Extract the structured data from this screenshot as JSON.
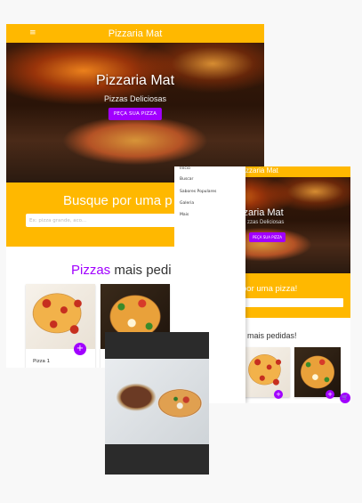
{
  "desktop": {
    "brand": "Pizzaria Mat",
    "menu_icon": "hamburger-icon",
    "hero": {
      "title": "Pizzaria Mat",
      "subtitle": "Pizzas Deliciosas",
      "button": "PEÇA SUA PIZZA"
    },
    "search": {
      "title": "Busque por uma p",
      "placeholder": "Ex: pizza grande, aco..."
    },
    "popular": {
      "title_accent": "Pizzas",
      "title_rest": " mais pedi"
    },
    "cards": [
      {
        "name": "Pizza 1"
      },
      {
        "name": ""
      }
    ],
    "add_button": "+"
  },
  "tablet": {
    "brand": "zzaria Mat",
    "hero": {
      "title": "zzaria Mat",
      "subtitle": "zzas Deliciosas",
      "button": "PEÇA SUA PIZZA"
    },
    "search": {
      "title": "por uma pizza!"
    },
    "popular": {
      "title_accent": "s",
      "title_rest": " mais pedidas!"
    },
    "drawer_items": [
      "Início",
      "Buscar",
      "Sabores Populares",
      "Galeria",
      "Mais"
    ],
    "cart_icon": "cart-icon"
  },
  "colors": {
    "primary": "#ffb800",
    "accent": "#a100ff"
  }
}
